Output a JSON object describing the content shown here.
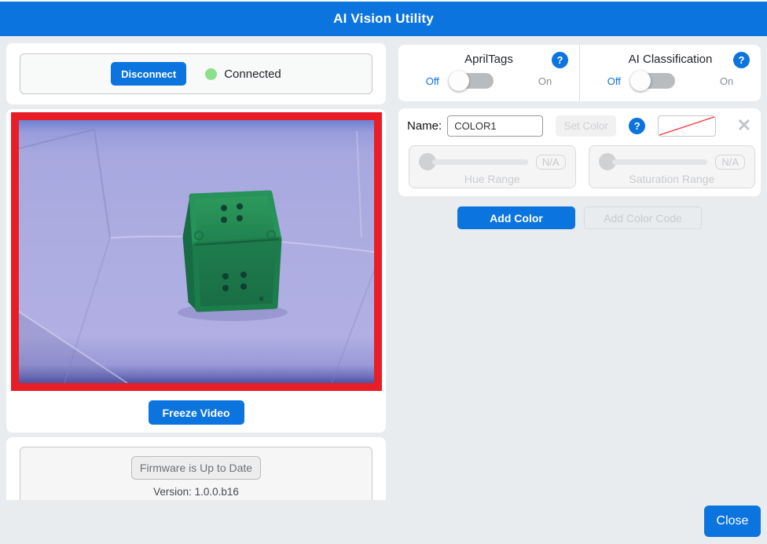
{
  "header": {
    "title": "AI Vision Utility"
  },
  "connection": {
    "disconnect_label": "Disconnect",
    "status": "Connected"
  },
  "video": {
    "freeze_label": "Freeze Video"
  },
  "firmware": {
    "status_label": "Firmware is Up to Date",
    "version": "Version: 1.0.0.b16"
  },
  "apriltags": {
    "label": "AprilTags",
    "off": "Off",
    "on": "On",
    "state": "off"
  },
  "classification": {
    "label": "AI Classification",
    "off": "Off",
    "on": "On",
    "state": "off"
  },
  "color_editor": {
    "name_label": "Name:",
    "name_value": "COLOR1",
    "set_color_label": "Set Color",
    "hue": {
      "label": "Hue Range",
      "value": "N/A"
    },
    "saturation": {
      "label": "Saturation Range",
      "value": "N/A"
    },
    "add_color_label": "Add Color",
    "add_color_code_label": "Add Color Code"
  },
  "footer": {
    "close_label": "Close"
  },
  "icons": {
    "help": "?",
    "close_x": "✕"
  },
  "colors": {
    "accent_blue": "#0c74df",
    "alert_red": "#e81d25",
    "connected_green": "#8ce08a",
    "cube_green_top": "#2a965a",
    "cube_green_front": "#1d7c4c"
  }
}
